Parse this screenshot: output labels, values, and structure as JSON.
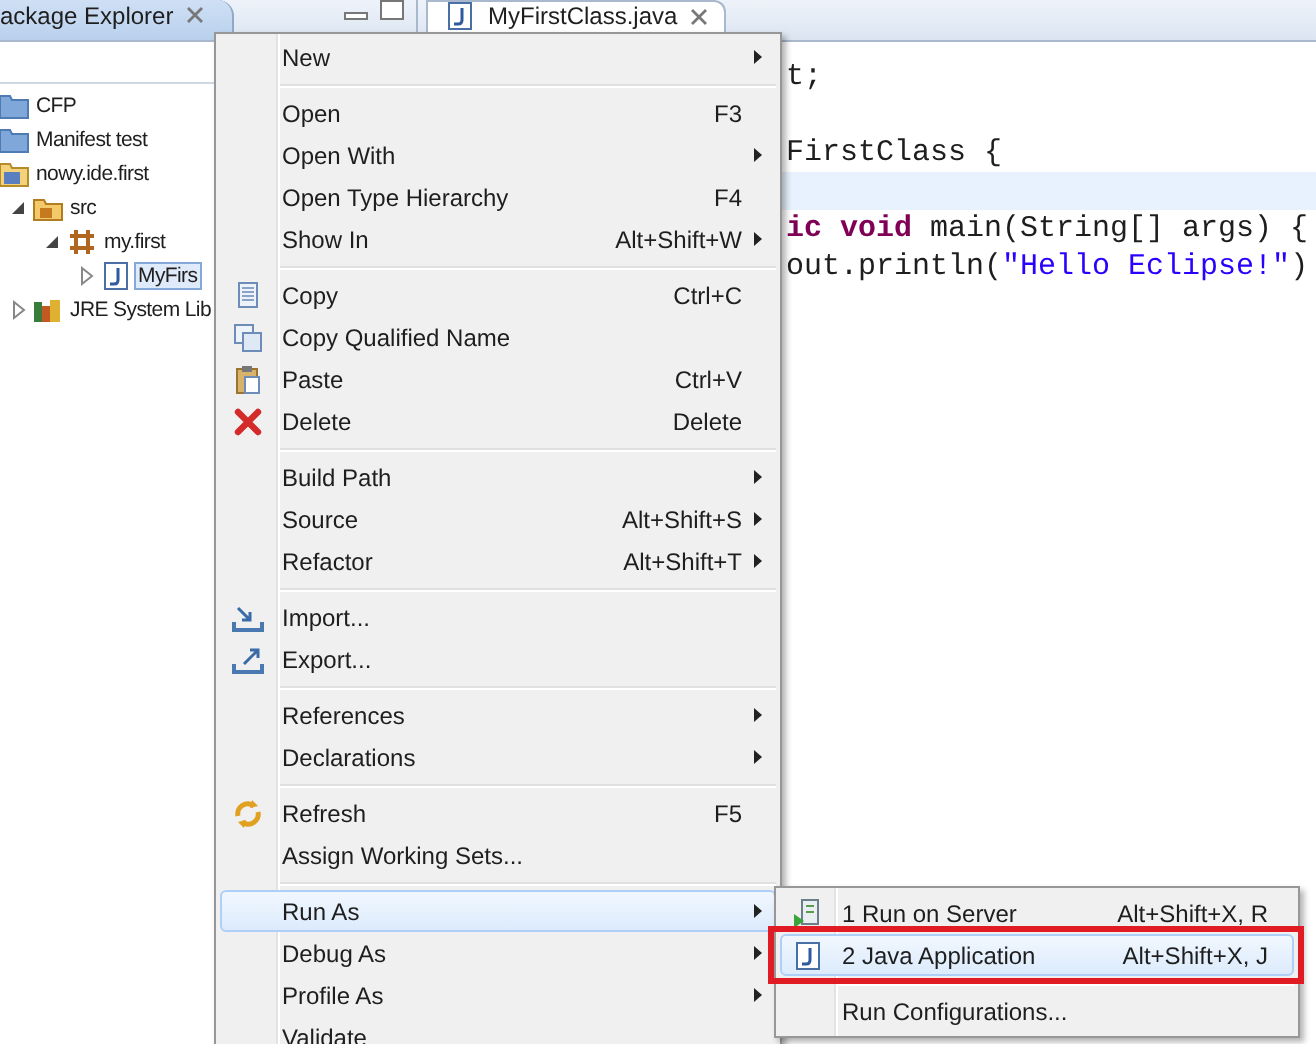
{
  "explorer": {
    "title": "ackage Explorer",
    "tree": [
      {
        "label": "CFP",
        "kind": "folder",
        "selected": false
      },
      {
        "label": "Manifest test",
        "kind": "folder",
        "selected": false
      },
      {
        "label": "nowy.ide.first",
        "kind": "project",
        "selected": false,
        "children": [
          {
            "label": "src",
            "kind": "source",
            "expanded": true,
            "selected": false,
            "children": [
              {
                "label": "my.first",
                "kind": "package",
                "expanded": true,
                "selected": false,
                "children": [
                  {
                    "label": "MyFirs",
                    "kind": "java",
                    "expanded": false,
                    "selected": true
                  }
                ]
              }
            ]
          },
          {
            "label": "JRE System Lib",
            "kind": "library",
            "expanded": false,
            "selected": false
          }
        ]
      }
    ]
  },
  "editor": {
    "tab": "MyFirstClass.java",
    "lines": [
      {
        "current": false,
        "segments": [
          {
            "text": "t;",
            "kind": "plain"
          }
        ]
      },
      {
        "current": false
      },
      {
        "current": false,
        "segments": [
          {
            "text": "FirstClass {",
            "kind": "plain"
          }
        ]
      },
      {
        "current": true
      },
      {
        "current": false,
        "segments": [
          {
            "text": "ic void",
            "kind": "keyword"
          },
          {
            "text": " main(String[] args) {",
            "kind": "plain"
          }
        ]
      },
      {
        "current": false,
        "segments": [
          {
            "text": "out.println(",
            "kind": "plain"
          },
          {
            "text": "\"Hello Eclipse!\"",
            "kind": "string"
          },
          {
            "text": ")",
            "kind": "plain"
          }
        ]
      }
    ]
  },
  "context_menu": {
    "groups": [
      [
        {
          "label": "New",
          "kind": "plain",
          "submenu": true,
          "selected": false
        }
      ],
      [
        {
          "label": "Open",
          "shortcut": "F3",
          "kind": "plain",
          "submenu": false,
          "selected": false
        },
        {
          "label": "Open With",
          "kind": "plain",
          "submenu": true,
          "selected": false
        },
        {
          "label": "Open Type Hierarchy",
          "shortcut": "F4",
          "kind": "plain",
          "submenu": false,
          "selected": false
        },
        {
          "label": "Show In",
          "shortcut": "Alt+Shift+W",
          "kind": "plain",
          "submenu": true,
          "selected": false
        }
      ],
      [
        {
          "label": "Copy",
          "shortcut": "Ctrl+C",
          "kind": "copy",
          "submenu": false,
          "selected": false
        },
        {
          "label": "Copy Qualified Name",
          "kind": "copyqualified",
          "submenu": false,
          "selected": false
        },
        {
          "label": "Paste",
          "shortcut": "Ctrl+V",
          "kind": "paste",
          "submenu": false,
          "selected": false
        },
        {
          "label": "Delete",
          "shortcut": "Delete",
          "kind": "delete",
          "submenu": false,
          "selected": false
        }
      ],
      [
        {
          "label": "Build Path",
          "kind": "plain",
          "submenu": true,
          "selected": false
        },
        {
          "label": "Source",
          "shortcut": "Alt+Shift+S",
          "kind": "plain",
          "submenu": true,
          "selected": false
        },
        {
          "label": "Refactor",
          "shortcut": "Alt+Shift+T",
          "kind": "plain",
          "submenu": true,
          "selected": false
        }
      ],
      [
        {
          "label": "Import...",
          "kind": "import",
          "submenu": false,
          "selected": false
        },
        {
          "label": "Export...",
          "kind": "export",
          "submenu": false,
          "selected": false
        }
      ],
      [
        {
          "label": "References",
          "kind": "plain",
          "submenu": true,
          "selected": false
        },
        {
          "label": "Declarations",
          "kind": "plain",
          "submenu": true,
          "selected": false
        }
      ],
      [
        {
          "label": "Refresh",
          "shortcut": "F5",
          "kind": "refresh",
          "submenu": false,
          "selected": false
        },
        {
          "label": "Assign Working Sets...",
          "kind": "plain",
          "submenu": false,
          "selected": false
        }
      ],
      [
        {
          "label": "Run As",
          "kind": "plain",
          "submenu": true,
          "selected": true
        },
        {
          "label": "Debug As",
          "kind": "plain",
          "submenu": true,
          "selected": false
        },
        {
          "label": "Profile As",
          "kind": "plain",
          "submenu": true,
          "selected": false
        },
        {
          "label": "Validate",
          "kind": "plain",
          "submenu": false,
          "selected": false
        }
      ]
    ]
  },
  "submenu": {
    "groups": [
      [
        {
          "label": "1 Run on Server",
          "shortcut": "Alt+Shift+X, R",
          "kind": "server",
          "selected": false,
          "annotated": false
        },
        {
          "label": "2 Java Application",
          "shortcut": "Alt+Shift+X, J",
          "kind": "java",
          "selected": true,
          "annotated": true
        }
      ],
      [
        {
          "label": "Run Configurations...",
          "kind": "plain",
          "selected": false,
          "annotated": false
        }
      ]
    ]
  }
}
